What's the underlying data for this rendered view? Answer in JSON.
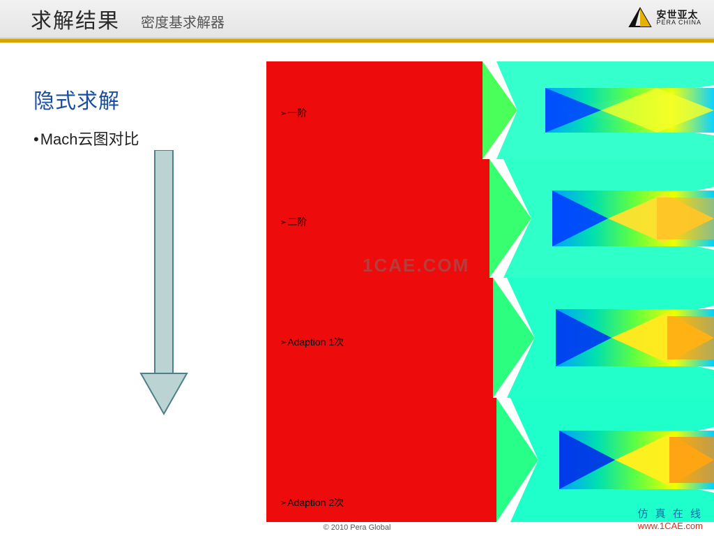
{
  "header": {
    "title": "求解结果",
    "subtitle": "密度基求解器"
  },
  "logo": {
    "cn": "安世亚太",
    "en": "PERA CHINA"
  },
  "left": {
    "section_title": "隐式求解",
    "bullet": "Mach云图对比"
  },
  "panels": [
    {
      "label": "一阶"
    },
    {
      "label": "二阶"
    },
    {
      "label": "Adaption 1次"
    },
    {
      "label": "Adaption 2次"
    }
  ],
  "watermark": "1CAE.COM",
  "footer": {
    "copyright": "© 2010 Pera Global",
    "brand_cn": "仿 真 在 线",
    "brand_url": "www.1CAE.com"
  }
}
